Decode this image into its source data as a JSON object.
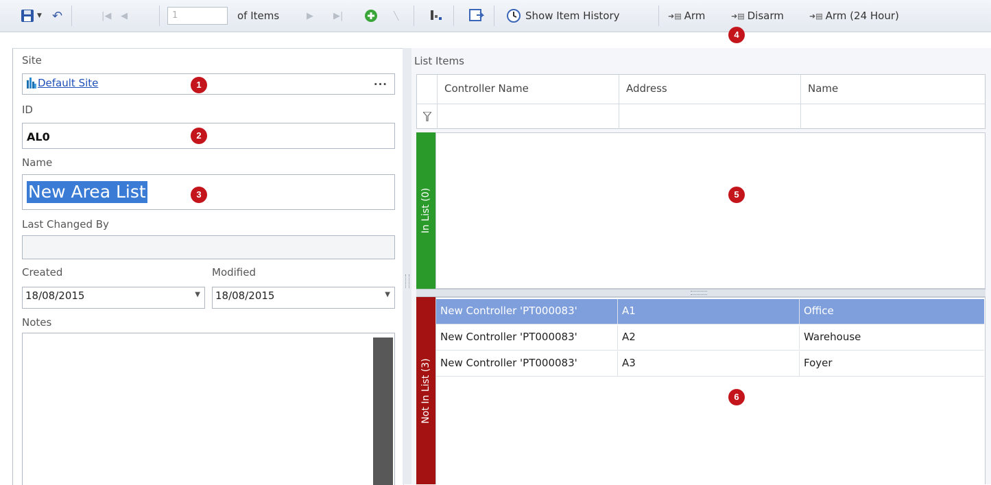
{
  "toolbar": {
    "page_value": "1",
    "of_items_label": "of Items",
    "show_history_label": "Show Item History",
    "arm_label": "Arm",
    "disarm_label": "Disarm",
    "arm24_label": "Arm (24 Hour)"
  },
  "form": {
    "site_label": "Site",
    "site_value": "Default Site",
    "site_browse": "...",
    "id_label": "ID",
    "id_value": "AL0",
    "name_label": "Name",
    "name_value": "New Area List",
    "last_changed_label": "Last Changed By",
    "last_changed_value": "",
    "created_label": "Created",
    "created_value": "18/08/2015",
    "modified_label": "Modified",
    "modified_value": "18/08/2015",
    "notes_label": "Notes"
  },
  "list": {
    "title": "List Items",
    "columns": [
      "Controller Name",
      "Address",
      "Name"
    ],
    "in_list_label": "In List (0)",
    "not_in_list_label": "Not In List (3)",
    "rows": [
      {
        "controller": "New Controller 'PT000083'",
        "address": "A1",
        "name": "Office"
      },
      {
        "controller": "New Controller 'PT000083'",
        "address": "A2",
        "name": "Warehouse"
      },
      {
        "controller": "New Controller 'PT000083'",
        "address": "A3",
        "name": "Foyer"
      }
    ]
  },
  "callouts": [
    "1",
    "2",
    "3",
    "4",
    "5",
    "6"
  ],
  "colors": {
    "in_list_tab": "#2a9a2a",
    "not_in_list_tab": "#a51212",
    "selected_row": "#7f9fdc",
    "callout": "#c4151c",
    "link": "#1d4fb8"
  }
}
